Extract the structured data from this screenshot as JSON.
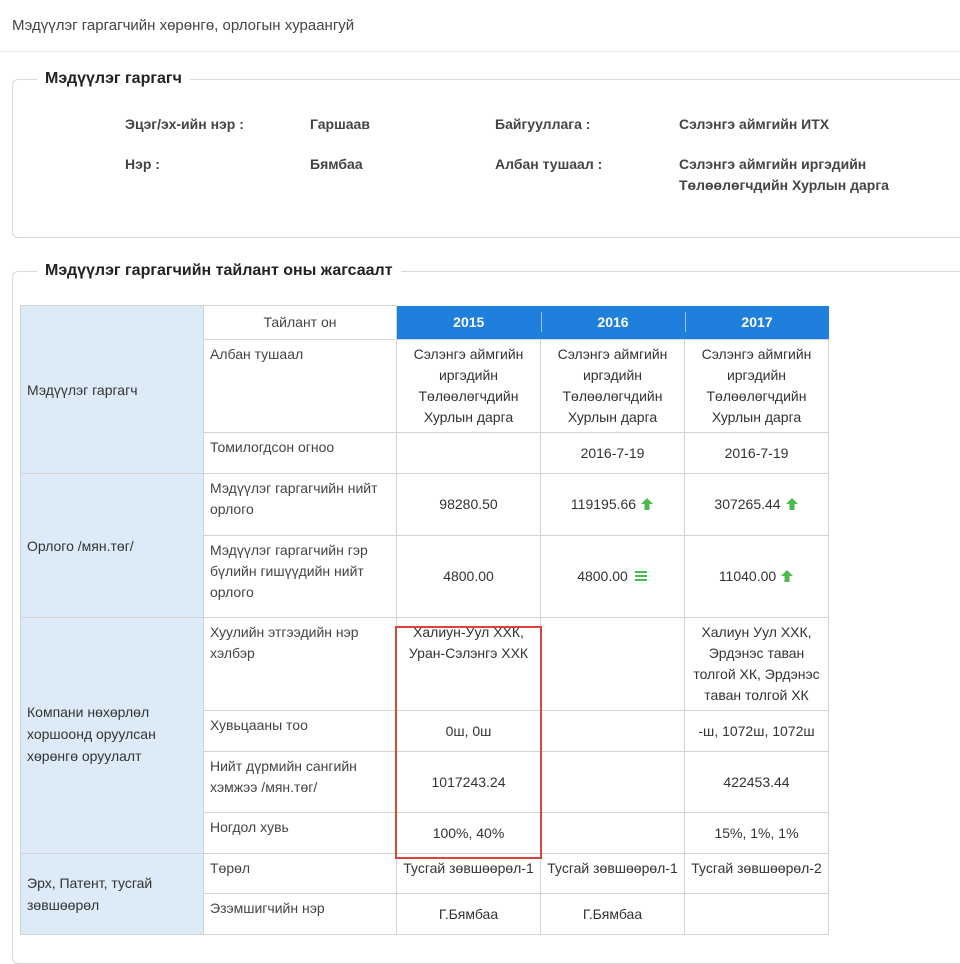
{
  "page": {
    "title": "Мэдүүлэг гаргагчийн хөрөнгө, орлогын хураангуй"
  },
  "declarant_panel": {
    "legend": "Мэдүүлэг гаргагч",
    "fields": {
      "surname_label": "Эцэг/эх-ийн нэр :",
      "surname_value": "Гаршаав",
      "name_label": "Нэр :",
      "name_value": "Бямбаа",
      "org_label": "Байгууллага :",
      "org_value": "Сэлэнгэ аймгийн ИТХ",
      "position_label": "Албан тушаал :",
      "position_value": "Сэлэнгэ аймгийн иргэдийн Төлөөлөгчдийн Хурлын дарга"
    }
  },
  "report_panel": {
    "legend": "Мэдүүлэг гаргагчийн тайлант оны жагсаалт",
    "year_header": "Тайлант он",
    "years": [
      "2015",
      "2016",
      "2017"
    ],
    "sections": {
      "declarant": "Мэдүүлэг гаргагч",
      "income": "Орлого /мян.төг/",
      "company": "Компани нөхөрлөл хоршоонд оруулсан хөрөнгө оруулалт",
      "license": "Эрх, Патент, тусгай зөвшөөрөл"
    },
    "rows": {
      "position": {
        "label": "Албан тушаал",
        "values": [
          "Сэлэнгэ аймгийн иргэдийн Төлөөлөгчдийн Хурлын дарга",
          "Сэлэнгэ аймгийн иргэдийн Төлөөлөгчдийн Хурлын дарга",
          "Сэлэнгэ аймгийн иргэдийн Төлөөлөгчдийн Хурлын дарга"
        ]
      },
      "appointed": {
        "label": "Томилогдсон огноо",
        "values": [
          "",
          "2016-7-19",
          "2016-7-19"
        ]
      },
      "total_income": {
        "label": "Мэдүүлэг гаргагчийн нийт орлого",
        "values": [
          "98280.50",
          "119195.66",
          "307265.44"
        ],
        "trend": [
          "none",
          "up",
          "up"
        ]
      },
      "family_income": {
        "label": "Мэдүүлэг гаргагчийн гэр бүлийн гишүүдийн нийт орлого",
        "values": [
          "4800.00",
          "4800.00",
          "11040.00"
        ],
        "trend": [
          "none",
          "equal",
          "up"
        ]
      },
      "entity_name": {
        "label": "Хуулийн этгээдийн нэр хэлбэр",
        "values": [
          "Халиун-Уул ХХК, Уран-Сэлэнгэ ХХК",
          "",
          "Халиун Уул ХХК, Эрдэнэс таван толгой ХК, Эрдэнэс таван толгой ХК"
        ]
      },
      "shares": {
        "label": "Хувьцааны тоо",
        "values": [
          "0ш, 0ш",
          "",
          "-ш, 1072ш, 1072ш"
        ]
      },
      "capital": {
        "label": "Нийт дүрмийн сангийн хэмжээ /мян.төг/",
        "values": [
          "1017243.24",
          "",
          "422453.44"
        ]
      },
      "stake": {
        "label": "Ногдол хувь",
        "values": [
          "100%, 40%",
          "",
          "15%, 1%, 1%"
        ]
      },
      "license_type": {
        "label": "Төрөл",
        "values": [
          "Тусгай зөвшөөрөл-1",
          "Тусгай зөвшөөрөл-1",
          "Тусгай зөвшөөрөл-2"
        ]
      },
      "owner": {
        "label": "Эзэмшигчийн нэр",
        "values": [
          "Г.Бямбаа",
          "Г.Бямбаа",
          ""
        ]
      }
    }
  },
  "colors": {
    "header_blue": "#1e7fdd",
    "section_bg": "#ddebf8",
    "trend_green": "#4cbb4c",
    "highlight_red": "#d9453a"
  }
}
